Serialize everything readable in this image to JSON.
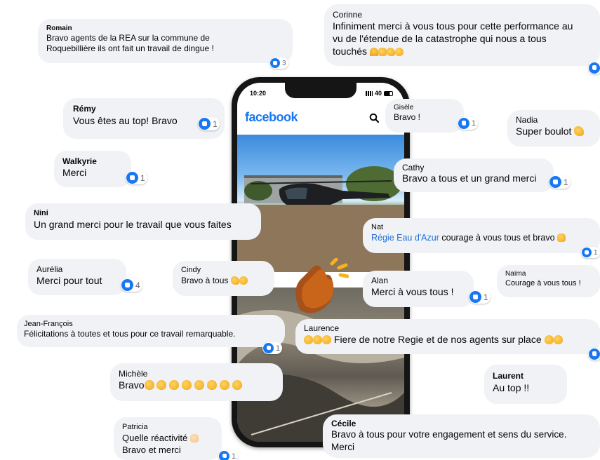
{
  "phone": {
    "time": "10:20",
    "signal_text": "40",
    "app_logo": "facebook",
    "icons": [
      "search-icon",
      "signal-icon",
      "battery-icon"
    ]
  },
  "colors": {
    "facebook_blue": "#1877f2",
    "bubble_bg": "#f0f2f5",
    "link_blue": "#216fdb",
    "clap_orange": "#c8651b"
  },
  "comments": {
    "romain": {
      "author": "Romain",
      "line1": "Bravo agents de la REA sur la commune de",
      "line2": "Roquebillière ils ont fait un travail de dingue !",
      "likes": "3"
    },
    "corinne": {
      "author": "Corinne",
      "line1": "Infiniment merci à vous tous pour cette performance au",
      "line2": "vu de l'étendue de la catastrophe qui nous a tous",
      "line3": "touchés"
    },
    "remy": {
      "author": "Rémy",
      "text": "Vous êtes au top! Bravo",
      "likes": "1"
    },
    "gisele": {
      "author": "Gisèle",
      "text": "Bravo !",
      "likes": "1"
    },
    "nadia": {
      "author": "Nadia",
      "text": "Super boulot"
    },
    "walkyrie": {
      "author": "Walkyrie",
      "text": "Merci",
      "likes": "1"
    },
    "cathy": {
      "author": "Cathy",
      "text": "Bravo a tous et un grand merci",
      "likes": "1"
    },
    "nini": {
      "author": "Nini",
      "text": "Un grand merci pour le travail que vous faites"
    },
    "nat": {
      "author": "Nat",
      "link": "Régie Eau d'Azur",
      "text": " courage à vous tous et bravo",
      "likes": "1"
    },
    "aurelia": {
      "author": "Aurélia",
      "text": "Merci pour tout",
      "likes": "4"
    },
    "cindy": {
      "author": "Cindy",
      "text": "Bravo à tous"
    },
    "alan": {
      "author": "Alan",
      "text": "Merci à vous tous !",
      "likes": "1"
    },
    "naima": {
      "author": "Naïma",
      "text": "Courage à vous tous !"
    },
    "jean_francois": {
      "author": "Jean-François",
      "text": "Félicitations à toutes et tous pour ce travail remarquable.",
      "likes": "1"
    },
    "laurence": {
      "author": "Laurence",
      "text": "Fiere de notre Regie et de nos agents sur place"
    },
    "michele": {
      "author": "Michèle",
      "text": "Bravo"
    },
    "laurent": {
      "author": "Laurent",
      "text": "Au top !!"
    },
    "patricia": {
      "author": "Patricia",
      "line1": "Quelle réactivité",
      "line2": "Bravo et merci",
      "likes": "1"
    },
    "cecile": {
      "author": "Cécile",
      "line1": "Bravo à tous pour votre engagement et sens du service.",
      "line2": "Merci"
    }
  }
}
